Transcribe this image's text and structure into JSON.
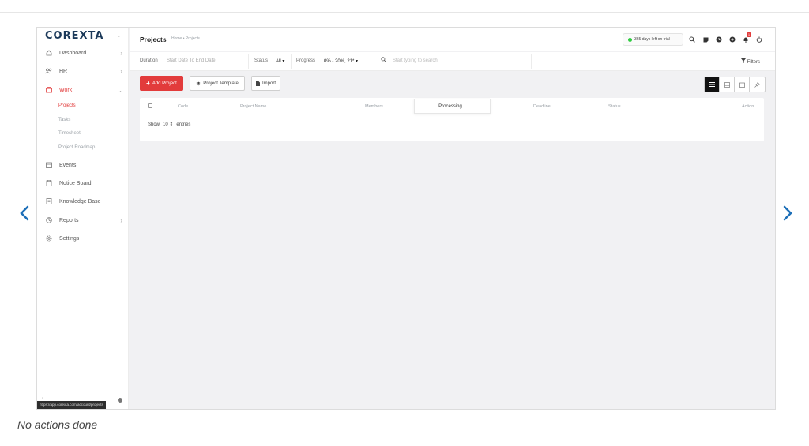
{
  "app": {
    "logo": "COREXTA",
    "brand_color": "#1c3a5a",
    "accent_color": "#e23b3b"
  },
  "sidebar": {
    "items": [
      {
        "label": "Dashboard",
        "icon": "home-icon"
      },
      {
        "label": "HR",
        "icon": "people-icon"
      },
      {
        "label": "Work",
        "icon": "briefcase-icon"
      },
      {
        "label": "Events",
        "icon": "calendar-icon"
      },
      {
        "label": "Notice Board",
        "icon": "clipboard-icon"
      },
      {
        "label": "Knowledge Base",
        "icon": "book-icon"
      },
      {
        "label": "Reports",
        "icon": "chart-icon"
      },
      {
        "label": "Settings",
        "icon": "gear-icon"
      }
    ],
    "work_subitems": [
      "Projects",
      "Tasks",
      "Timesheet",
      "Project Roadmap"
    ],
    "status_url": "https://app.corexta.com/account/projects"
  },
  "header": {
    "title": "Projects",
    "breadcrumb": "Home • Projects",
    "trial_text": "365 days left on trial",
    "notification_count": "1"
  },
  "filters": {
    "duration_label": "Duration",
    "duration_value": "Start Date To End Date",
    "status_label": "Status",
    "status_value": "All",
    "progress_label": "Progress",
    "progress_value": "0% - 20%, 21",
    "search_placeholder": "Start typing to search",
    "filters_label": "Filters"
  },
  "actions": {
    "add_project": "Add Project",
    "project_template": "Project Template",
    "import": "Import"
  },
  "table": {
    "columns": [
      "Code",
      "Project Name",
      "Members",
      "Deadline",
      "Status",
      "Action"
    ],
    "processing_text": "Processing...",
    "show_label": "Show",
    "entries_value": "10",
    "entries_label": "entries"
  },
  "caption": "No actions done"
}
